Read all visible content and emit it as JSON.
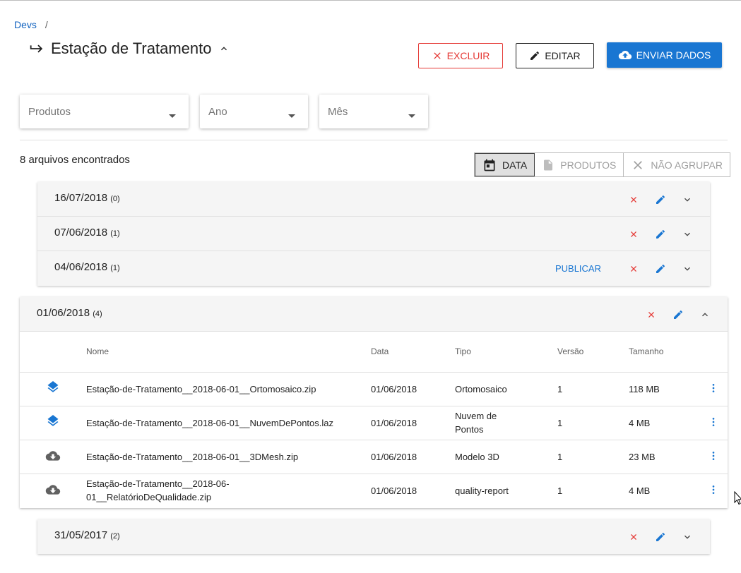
{
  "breadcrumb": {
    "root": "Devs",
    "separator": "/"
  },
  "page": {
    "title": "Estação de Tratamento"
  },
  "toolbar": {
    "delete_label": "EXCLUIR",
    "edit_label": "EDITAR",
    "upload_label": "ENVIAR DADOS"
  },
  "filters": {
    "produtos": "Produtos",
    "ano": "Ano",
    "mes": "Mês"
  },
  "results": {
    "count_text": "8 arquivos encontrados"
  },
  "grouping": {
    "date": "DATA",
    "products": "PRODUTOS",
    "none": "NÃO AGRUPAR"
  },
  "groups": [
    {
      "date": "16/07/2018",
      "count": "(0)"
    },
    {
      "date": "07/06/2018",
      "count": "(1)"
    },
    {
      "date": "04/06/2018",
      "count": "(1)",
      "publish_label": "PUBLICAR"
    },
    {
      "date": "01/06/2018",
      "count": "(4)"
    },
    {
      "date": "31/05/2017",
      "count": "(2)"
    }
  ],
  "table": {
    "headers": {
      "nome": "Nome",
      "data": "Data",
      "tipo": "Tipo",
      "versao": "Versão",
      "tamanho": "Tamanho"
    },
    "rows": [
      {
        "icon": "layers-icon",
        "nome": "Estação-de-Tratamento__2018-06-01__Ortomosaico.zip",
        "data": "01/06/2018",
        "tipo": "Ortomosaico",
        "versao": "1",
        "tamanho": "118 MB"
      },
      {
        "icon": "layers-icon",
        "nome": "Estação-de-Tratamento__2018-06-01__NuvemDePontos.laz",
        "data": "01/06/2018",
        "tipo": "Nuvem de Pontos",
        "versao": "1",
        "tamanho": "4 MB"
      },
      {
        "icon": "cloud-download-icon",
        "nome": "Estação-de-Tratamento__2018-06-01__3DMesh.zip",
        "data": "01/06/2018",
        "tipo": "Modelo 3D",
        "versao": "1",
        "tamanho": "23 MB"
      },
      {
        "icon": "cloud-download-icon",
        "nome": "Estação-de-Tratamento__2018-06-01__RelatórioDeQualidade.zip",
        "data": "01/06/2018",
        "tipo": "quality-report",
        "versao": "1",
        "tamanho": "4 MB"
      }
    ]
  },
  "colors": {
    "primary": "#1976d2",
    "danger": "#e53935"
  }
}
